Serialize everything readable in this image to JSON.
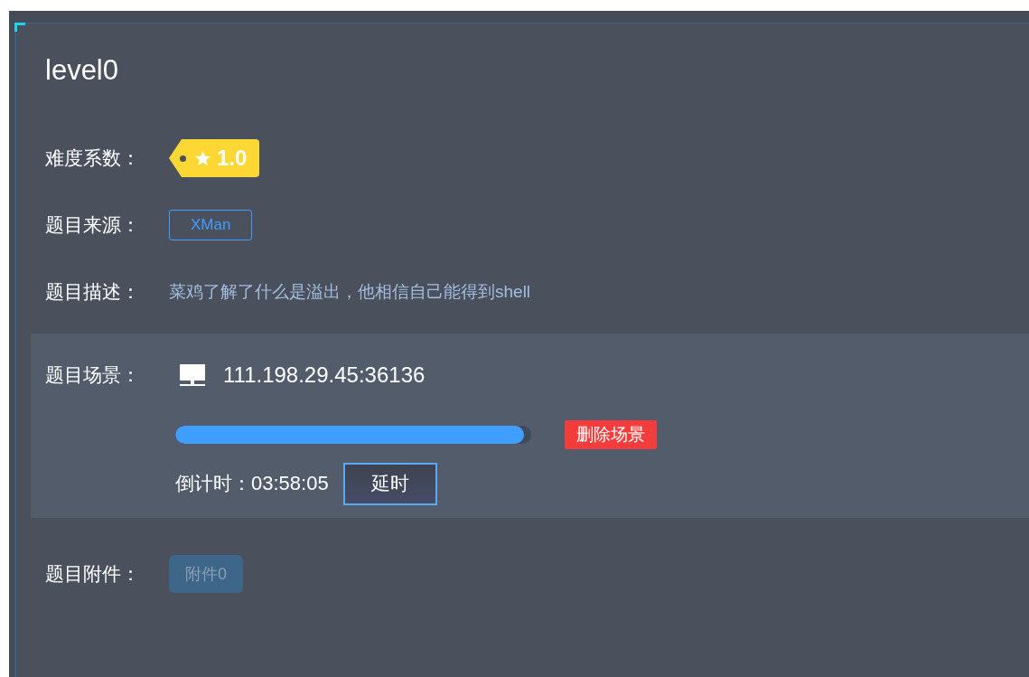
{
  "title": "level0",
  "difficulty": {
    "label": "难度系数：",
    "value": "1.0"
  },
  "source": {
    "label": "题目来源：",
    "tag": "XMan"
  },
  "description": {
    "label": "题目描述：",
    "text": "菜鸡了解了什么是溢出，他相信自己能得到shell"
  },
  "scene": {
    "label": "题目场景：",
    "address": "111.198.29.45:36136",
    "level": 0.98,
    "delete_button": "删除场景",
    "countdown_label": "倒计时：",
    "countdown": "03:58:05",
    "extend_button": "延时"
  },
  "attachments": {
    "label": "题目附件：",
    "files": [
      {
        "name": "附件0",
        "disabled": true
      }
    ]
  }
}
